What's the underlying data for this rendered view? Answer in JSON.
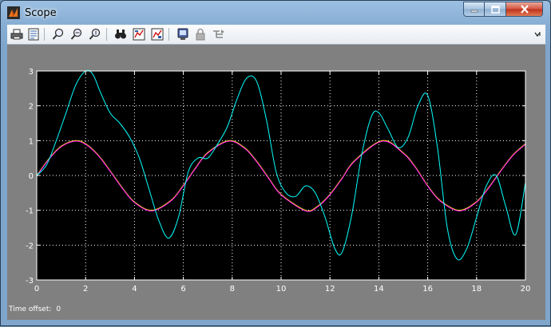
{
  "window": {
    "title": "Scope"
  },
  "toolbar": {
    "icons": [
      "print-icon",
      "parameters-icon",
      "zoom-icon",
      "zoom-x-icon",
      "zoom-y-icon",
      "autoscale-icon",
      "save-axes-icon",
      "restore-axes-icon",
      "floating-scope-icon",
      "lock-icon",
      "signal-selection-icon"
    ]
  },
  "status": {
    "time_offset_label": "Time offset:",
    "time_offset_value": "0"
  },
  "colors": {
    "sine": "#ff00ff",
    "sine2": "#ffff00",
    "scope_signal": "#00ffff",
    "plot_bg": "#000000",
    "frame_bg": "#808080"
  },
  "chart_data": {
    "type": "line",
    "xlim": [
      0,
      20
    ],
    "ylim": [
      -3,
      3
    ],
    "xticks": [
      "0",
      "2",
      "4",
      "6",
      "8",
      "10",
      "12",
      "14",
      "16",
      "18",
      "20"
    ],
    "yticks": [
      "3",
      "2",
      "1",
      "0",
      "-1",
      "-2",
      "-3"
    ],
    "grid": true,
    "series": [
      {
        "color": "#ffff00",
        "x": [
          0,
          0.5,
          1,
          1.57,
          2,
          2.5,
          3,
          3.5,
          4,
          4.71,
          5.5,
          6,
          6.5,
          7,
          7.85,
          8.5,
          9,
          9.5,
          10,
          11,
          11.5,
          12,
          12.5,
          13,
          14.14,
          15,
          15.5,
          16,
          16.5,
          17.28,
          18,
          18.5,
          19,
          19.5,
          20
        ],
        "y": [
          0,
          0.48,
          0.84,
          1,
          0.91,
          0.6,
          0.14,
          -0.35,
          -0.76,
          -1,
          -0.71,
          -0.28,
          0.22,
          0.66,
          1,
          0.8,
          0.41,
          -0.08,
          -0.54,
          -1,
          -0.88,
          -0.54,
          -0.07,
          0.42,
          1,
          0.65,
          0.24,
          -0.29,
          -0.71,
          -1,
          -0.75,
          -0.34,
          0.15,
          0.6,
          0.91
        ]
      },
      {
        "color": "#ff00ff",
        "x": [
          0,
          0.5,
          1,
          1.57,
          2,
          2.5,
          3,
          3.5,
          4,
          4.71,
          5.5,
          6,
          6.5,
          7,
          7.85,
          8.5,
          9,
          9.5,
          10,
          11,
          11.5,
          12,
          12.5,
          13,
          14.14,
          15,
          15.5,
          16,
          16.5,
          17.28,
          18,
          18.5,
          19,
          19.5,
          20
        ],
        "y": [
          0,
          0.48,
          0.84,
          1,
          0.91,
          0.6,
          0.14,
          -0.35,
          -0.76,
          -1,
          -0.71,
          -0.28,
          0.22,
          0.66,
          1,
          0.8,
          0.41,
          -0.08,
          -0.54,
          -1,
          -0.88,
          -0.54,
          -0.07,
          0.42,
          1,
          0.65,
          0.24,
          -0.29,
          -0.71,
          -1,
          -0.75,
          -0.34,
          0.15,
          0.6,
          0.91
        ]
      },
      {
        "color": "#00ffff",
        "x": [
          0,
          0.4,
          0.8,
          1.2,
          1.6,
          2.0,
          2.3,
          2.6,
          3.0,
          3.4,
          3.8,
          4.2,
          4.6,
          5.0,
          5.4,
          5.8,
          6.2,
          6.6,
          7.0,
          7.4,
          7.8,
          8.2,
          8.6,
          9.0,
          9.4,
          9.8,
          10.2,
          10.6,
          11.0,
          11.4,
          11.8,
          12.2,
          12.5,
          12.9,
          13.3,
          13.7,
          14.0,
          14.4,
          14.8,
          15.2,
          15.6,
          16.0,
          16.4,
          16.8,
          17.2,
          17.6,
          18.0,
          18.4,
          18.8,
          19.2,
          19.6,
          20.0
        ],
        "y": [
          0,
          0.3,
          1.0,
          1.8,
          2.6,
          3.0,
          2.9,
          2.4,
          1.8,
          1.5,
          1.1,
          0.5,
          -0.4,
          -1.3,
          -1.8,
          -1.2,
          0.1,
          0.5,
          0.5,
          0.9,
          1.4,
          2.2,
          2.8,
          2.7,
          1.6,
          0.1,
          -0.5,
          -0.6,
          -0.3,
          -0.5,
          -1.2,
          -2.1,
          -2.2,
          -1.1,
          0.6,
          1.7,
          1.8,
          1.3,
          0.8,
          1.1,
          2.0,
          2.3,
          0.8,
          -1.5,
          -2.4,
          -2.1,
          -1.2,
          -0.3,
          0.0,
          -0.9,
          -1.7,
          -0.2
        ]
      }
    ]
  }
}
